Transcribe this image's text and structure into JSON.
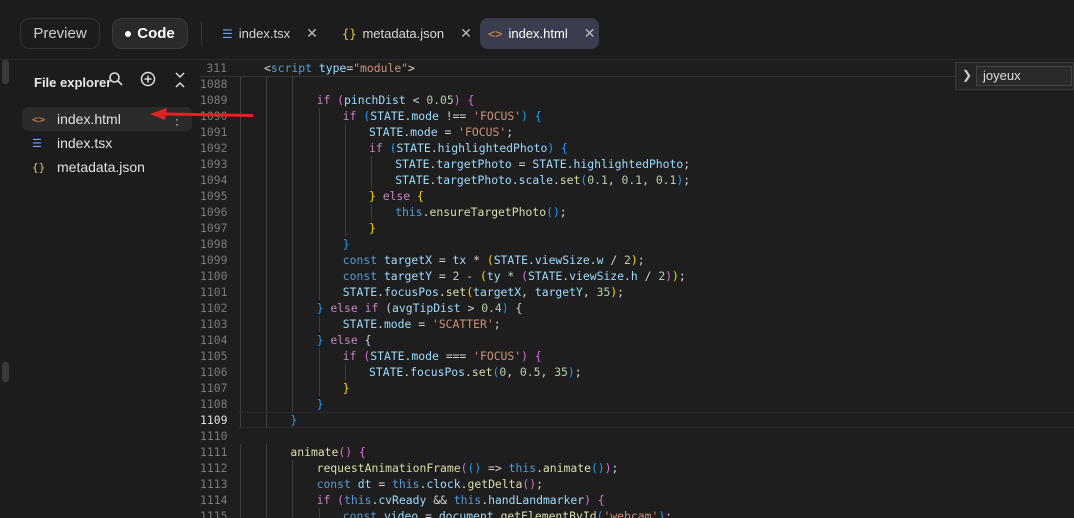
{
  "topbar": {
    "preview_label": "Preview",
    "code_label": "Code",
    "tabs": [
      {
        "icon": "list-icon",
        "label": "index.tsx",
        "icon_color": "#6aa8ff"
      },
      {
        "icon": "braces-icon",
        "label": "metadata.json",
        "icon_color": "#e8c547"
      },
      {
        "icon": "html-icon",
        "label": "index.html",
        "icon_color": "#e8853b",
        "active": true
      }
    ]
  },
  "explorer": {
    "title": "File explorer",
    "files": [
      {
        "label": "index.html",
        "icon": "html-icon",
        "selected": true
      },
      {
        "label": "index.tsx",
        "icon": "list-icon"
      },
      {
        "label": "metadata.json",
        "icon": "braces-icon"
      }
    ]
  },
  "search": {
    "value": "joyeux"
  },
  "colors": {
    "accent_arrow": "#e02424",
    "active_tab": "#3a3d4d"
  },
  "editor": {
    "sticky": {
      "num": "311",
      "code": "<script type=\"module\">"
    },
    "lines": [
      {
        "num": "1088",
        "code": ""
      },
      {
        "num": "1089",
        "code": "if (pinchDist < 0.05) {"
      },
      {
        "num": "1090",
        "code": "if (STATE.mode !== 'FOCUS') {"
      },
      {
        "num": "1091",
        "code": "STATE.mode = 'FOCUS';"
      },
      {
        "num": "1092",
        "code": "if (STATE.highlightedPhoto) {"
      },
      {
        "num": "1093",
        "code": "STATE.targetPhoto = STATE.highlightedPhoto;"
      },
      {
        "num": "1094",
        "code": "STATE.targetPhoto.scale.set(0.1, 0.1, 0.1);"
      },
      {
        "num": "1095",
        "code": "} else {"
      },
      {
        "num": "1096",
        "code": "this.ensureTargetPhoto();"
      },
      {
        "num": "1097",
        "code": "}"
      },
      {
        "num": "1098",
        "code": "}"
      },
      {
        "num": "1099",
        "code": "const targetX = tx * (STATE.viewSize.w / 2);"
      },
      {
        "num": "1100",
        "code": "const targetY = 2 - (ty * (STATE.viewSize.h / 2));"
      },
      {
        "num": "1101",
        "code": "STATE.focusPos.set(targetX, targetY, 35);"
      },
      {
        "num": "1102",
        "code": "} else if (avgTipDist > 0.4) {"
      },
      {
        "num": "1103",
        "code": "STATE.mode = 'SCATTER';"
      },
      {
        "num": "1104",
        "code": "} else {"
      },
      {
        "num": "1105",
        "code": "if (STATE.mode === 'FOCUS') {"
      },
      {
        "num": "1106",
        "code": "STATE.focusPos.set(0, 0.5, 35);"
      },
      {
        "num": "1107",
        "code": "}"
      },
      {
        "num": "1108",
        "code": "}"
      },
      {
        "num": "1109",
        "code": "}"
      },
      {
        "num": "1110",
        "code": ""
      },
      {
        "num": "1111",
        "code": "animate() {"
      },
      {
        "num": "1112",
        "code": "requestAnimationFrame(() => this.animate());"
      },
      {
        "num": "1113",
        "code": "const dt = this.clock.getDelta();"
      },
      {
        "num": "1114",
        "code": "if (this.cvReady && this.handLandmarker) {"
      },
      {
        "num": "1115",
        "code": "const video = document.getElementById('webcam');"
      }
    ]
  }
}
